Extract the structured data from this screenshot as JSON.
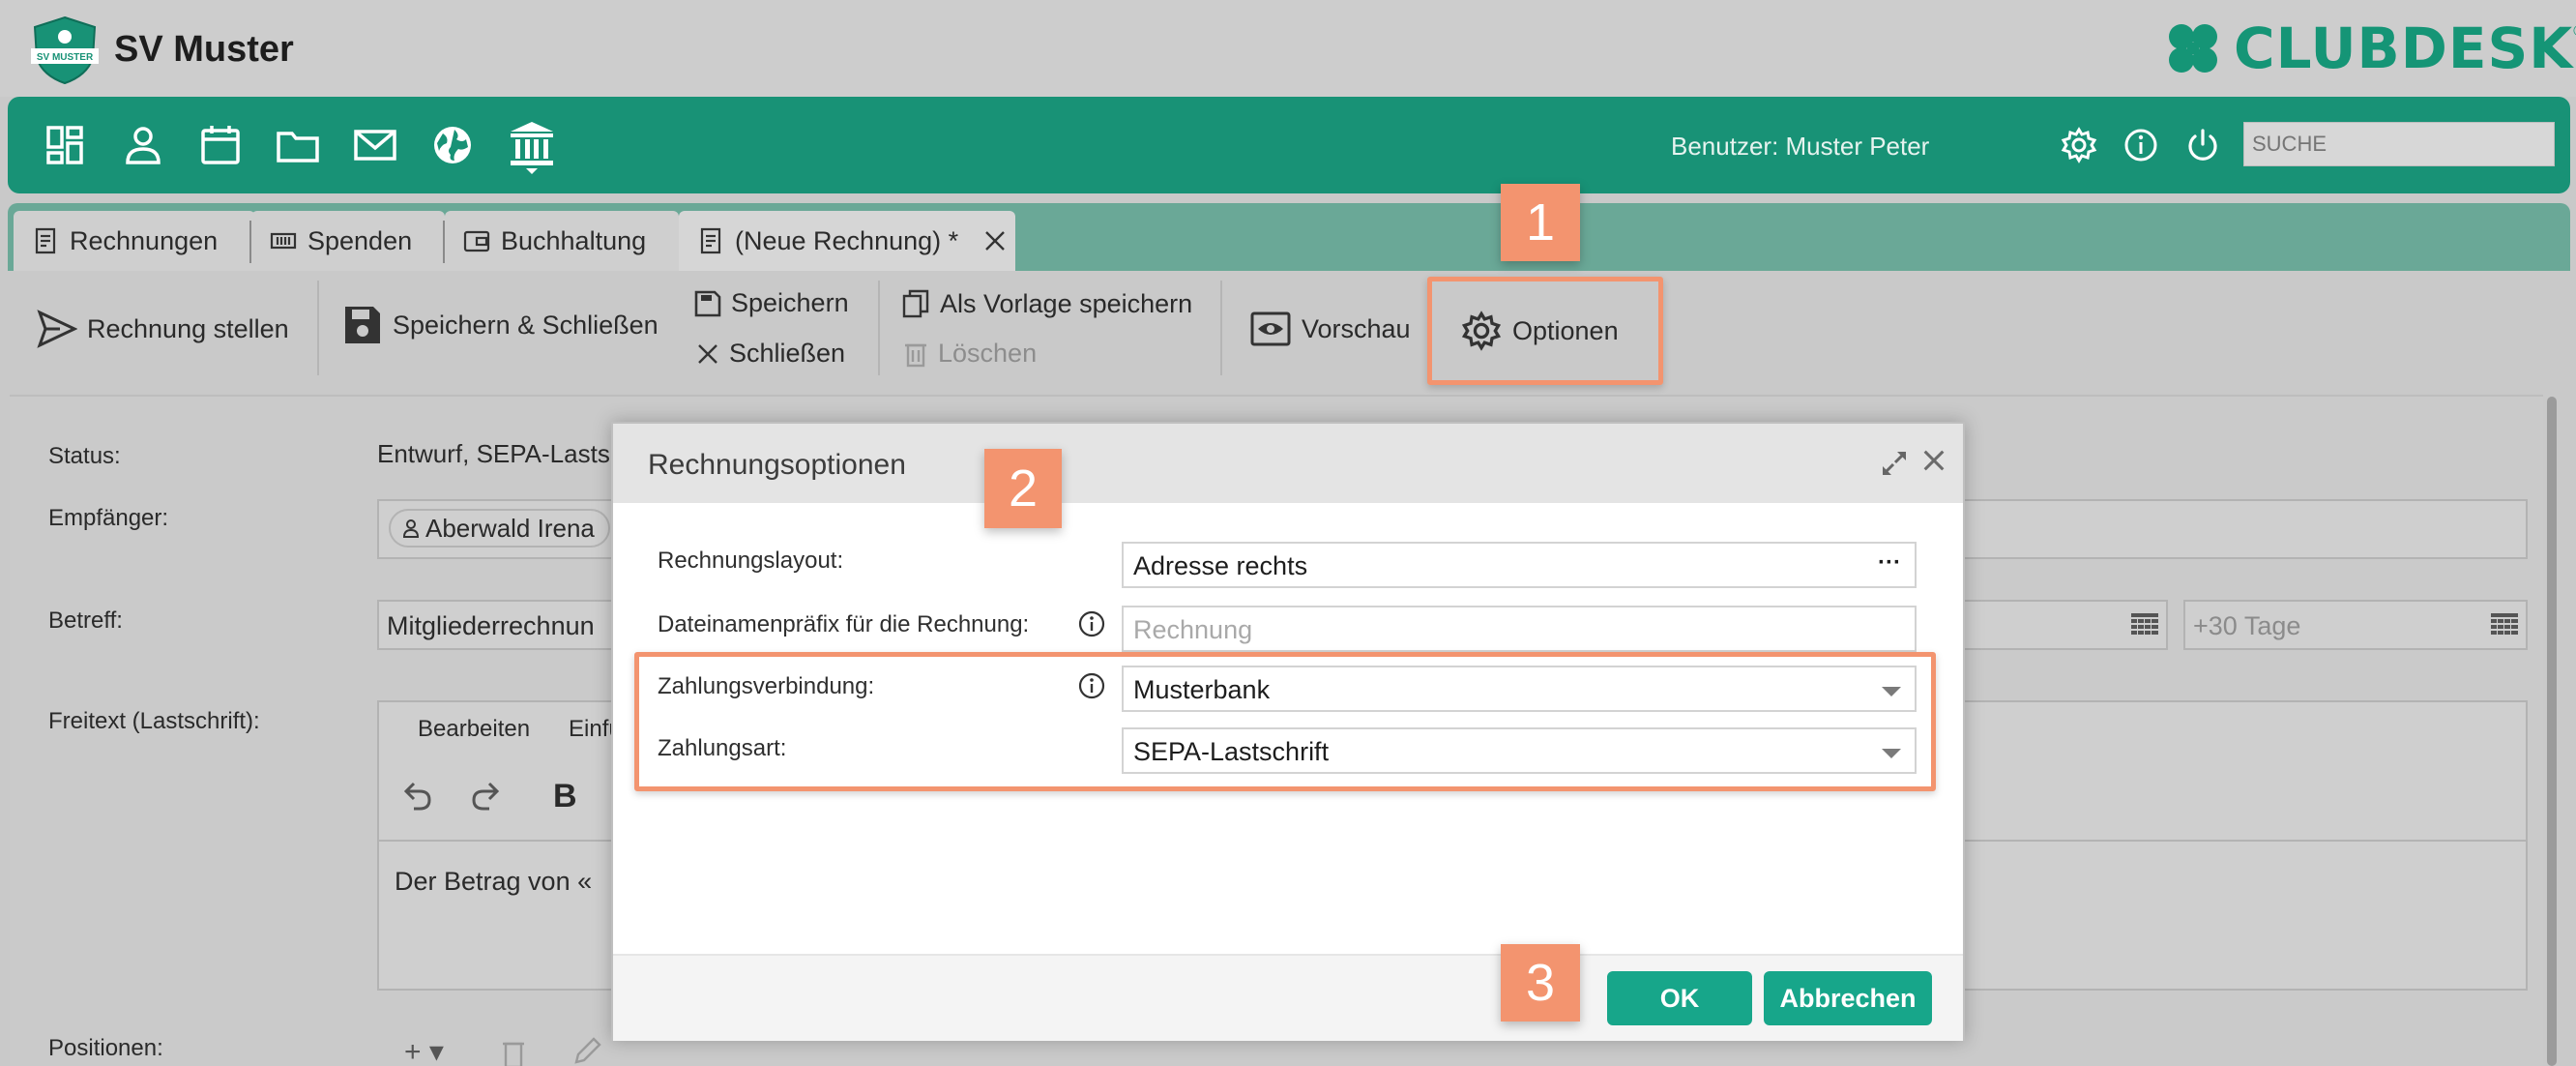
{
  "header": {
    "club_name": "SV Muster",
    "logo_text": "SV MUSTER",
    "brand": "CLUBDESK",
    "brand_mark": "®"
  },
  "nav": {
    "icons": [
      "dashboard-icon",
      "person-icon",
      "calendar-icon",
      "folder-icon",
      "mail-icon",
      "globe-icon",
      "bank-icon"
    ],
    "user": "Benutzer: Muster Peter",
    "search_placeholder": "SUCHE"
  },
  "tabs": [
    {
      "label": "Rechnungen",
      "icon": "invoice-icon"
    },
    {
      "label": "Spenden",
      "icon": "donation-icon"
    },
    {
      "label": "Buchhaltung",
      "icon": "wallet-icon"
    },
    {
      "label": "(Neue Rechnung) *",
      "icon": "invoice-icon",
      "active": true
    }
  ],
  "toolbar": {
    "send": "Rechnung stellen",
    "save_close": "Speichern & Schließen",
    "save": "Speichern",
    "close": "Schließen",
    "save_template": "Als Vorlage speichern",
    "delete": "Löschen",
    "preview": "Vorschau",
    "options": "Optionen"
  },
  "form": {
    "status_label": "Status:",
    "status_value": "Entwurf, SEPA-Lasts",
    "recipient_label": "Empfänger:",
    "recipient_chip": "Aberwald Irena",
    "subject_label": "Betreff:",
    "subject_value": "Mitgliederrechnun",
    "due_placeholder": "+30 Tage",
    "freetext_label": "Freitext (Lastschrift):",
    "editor_menu_edit": "Bearbeiten",
    "editor_menu_insert": "Einfü",
    "editor_bold": "B",
    "editor_text": "Der Betrag von «",
    "positions_label": "Positionen:"
  },
  "modal": {
    "title": "Rechnungsoptionen",
    "layout_label": "Rechnungslayout:",
    "layout_value": "Adresse rechts",
    "layout_more": "···",
    "prefix_label": "Dateinamenpräfix für die Rechnung:",
    "prefix_placeholder": "Rechnung",
    "connection_label": "Zahlungsverbindung:",
    "connection_value": "Musterbank",
    "method_label": "Zahlungsart:",
    "method_value": "SEPA-Lastschrift",
    "ok": "OK",
    "cancel": "Abbrechen"
  },
  "callouts": [
    "1",
    "2",
    "3"
  ],
  "colors": {
    "brand_green": "#189276",
    "accent_orange": "#f3946f",
    "button_green": "#17a68a"
  }
}
